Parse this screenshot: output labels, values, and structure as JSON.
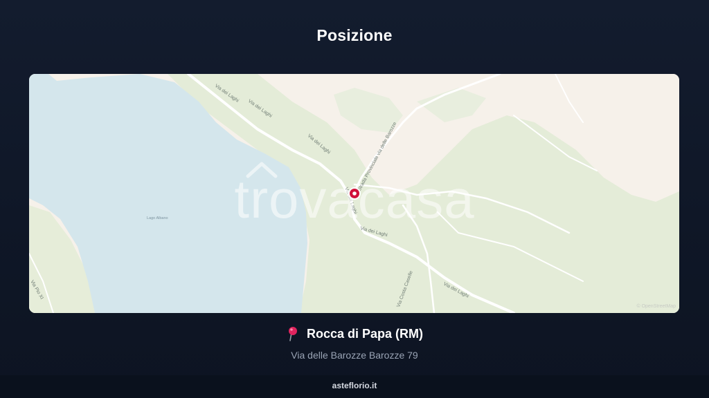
{
  "section": {
    "title": "Posizione"
  },
  "map": {
    "watermark": "trovacasa",
    "attribution": "© OpenStreetMap",
    "lake_label": "Lago Albano",
    "road_labels": {
      "via_dei_laghi_1": "Via dei Laghi",
      "via_dei_laghi_2": "Via dei Laghi",
      "via_dei_laghi_3": "Via dei Laghi",
      "via_dei_laghi_4": "Via dei Laghi",
      "via_dei_laghi_5": "Via dei Laghi",
      "strada_provinciale": "Strada Provinciale via delle Barozze",
      "via_dei_laghi_pin": "Via dei Laghi",
      "via_pio_xi": "Via Pio XI",
      "via_costa": "Via Costa Caselle"
    },
    "colors": {
      "lake": "#d4e6ec",
      "forest": "#e4ecd8",
      "urban": "#f6f1ea",
      "marker": "#d0103a"
    }
  },
  "location": {
    "pin_icon": "round-pushpin-icon",
    "title": "Rocca di Papa (RM)",
    "address": "Via delle Barozze Barozze 79"
  },
  "footer": {
    "site": "asteflorio.it"
  }
}
